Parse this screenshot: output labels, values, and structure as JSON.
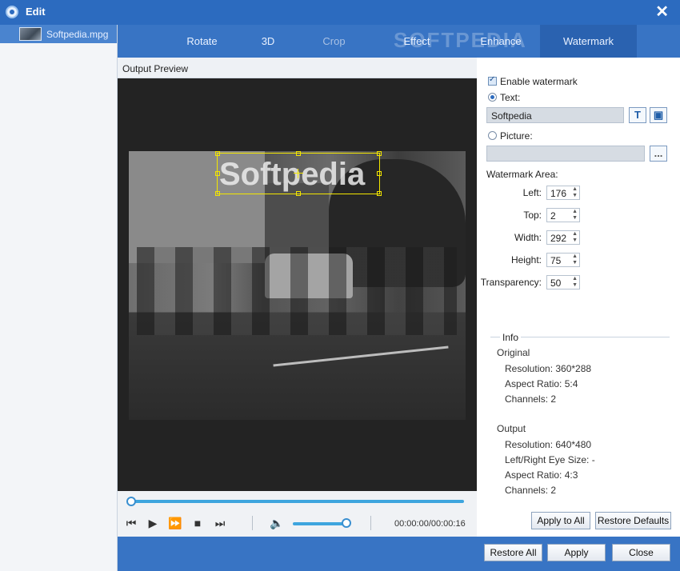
{
  "window": {
    "title": "Edit",
    "close_icon": "close-icon"
  },
  "sidebar": {
    "file_name": "Softpedia.mpg"
  },
  "tabs": [
    {
      "label": "Rotate"
    },
    {
      "label": "3D"
    },
    {
      "label": "Crop"
    },
    {
      "label": "Effect"
    },
    {
      "label": "Enhance"
    },
    {
      "label": "Watermark"
    }
  ],
  "brand_watermark": "SOFTPEDIA",
  "preview": {
    "header": "Output Preview",
    "watermark_text": "Softpedia",
    "time": "00:00:00/00:00:16",
    "progress": 0.0,
    "volume": 0.88
  },
  "watermark": {
    "enable_label": "Enable watermark",
    "enabled": true,
    "text_label": "Text:",
    "text_value": "Softpedia",
    "picture_label": "Picture:",
    "picture_value": "",
    "browse_label": "...",
    "area_label": "Watermark Area:",
    "fields": {
      "left": {
        "label": "Left:",
        "value": "176"
      },
      "top": {
        "label": "Top:",
        "value": "2"
      },
      "width": {
        "label": "Width:",
        "value": "292"
      },
      "height": {
        "label": "Height:",
        "value": "75"
      },
      "transparency": {
        "label": "Transparency:",
        "value": "50"
      }
    }
  },
  "info": {
    "title": "Info",
    "original": {
      "heading": "Original",
      "resolution": "Resolution: 360*288",
      "aspect": "Aspect Ratio: 5:4",
      "channels": "Channels: 2"
    },
    "output": {
      "heading": "Output",
      "resolution": "Resolution: 640*480",
      "eye_size": "Left/Right Eye Size: -",
      "aspect": "Aspect Ratio: 4:3",
      "channels": "Channels: 2"
    }
  },
  "buttons": {
    "apply_to_all": "Apply to All",
    "restore_defaults": "Restore Defaults",
    "restore_all": "Restore All",
    "apply": "Apply",
    "close": "Close"
  },
  "colors": {
    "titlebar": "#2c6bbf",
    "tabbar": "#3874c4",
    "active_tab": "#2a62b0",
    "watermark_box": "#f3e600",
    "slider": "#3ea5de"
  }
}
